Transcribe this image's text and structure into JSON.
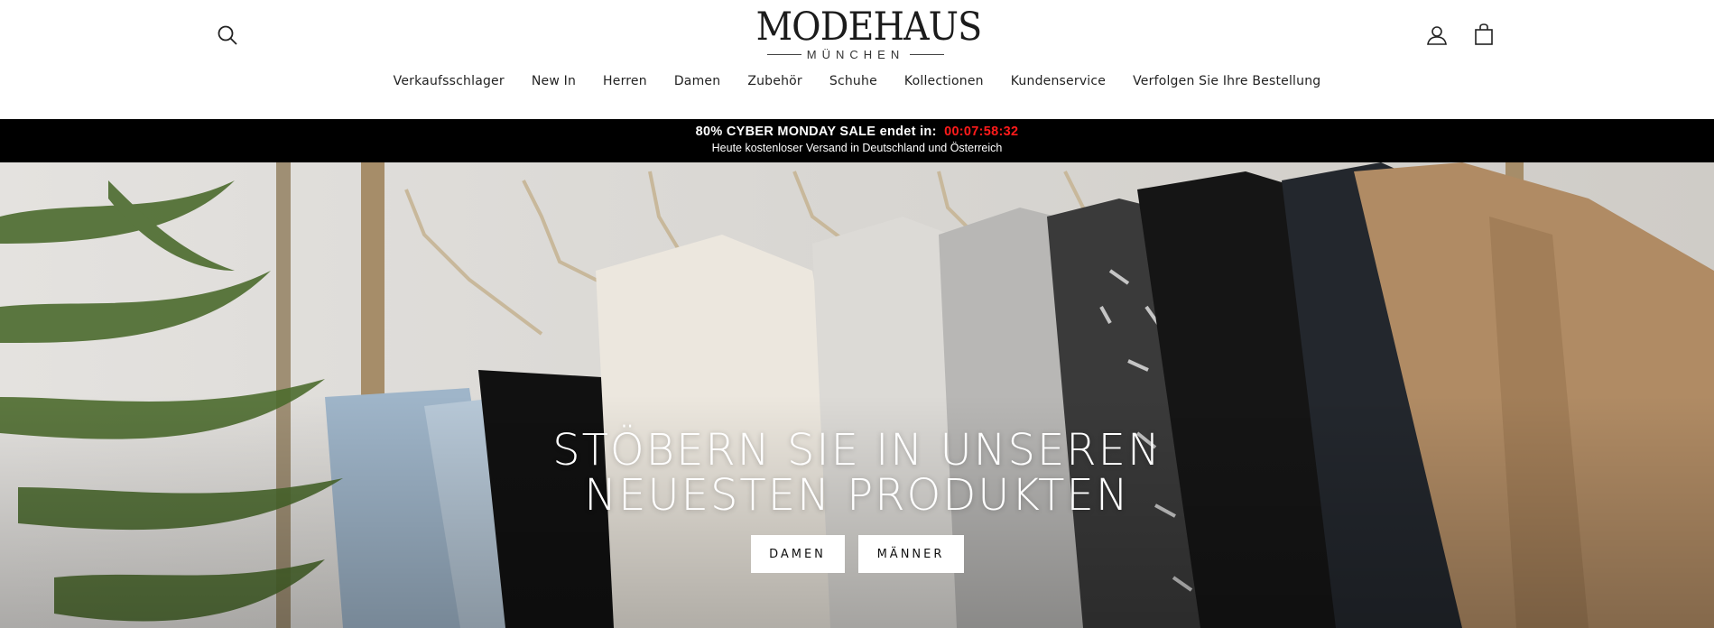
{
  "header": {
    "logo": {
      "main": "MODEHAUS",
      "sub": "MÜNCHEN"
    },
    "icons": {
      "search": "search-icon",
      "account": "user-icon",
      "cart": "shopping-bag-icon"
    }
  },
  "nav": {
    "items": [
      {
        "label": "Verkaufsschlager"
      },
      {
        "label": "New In"
      },
      {
        "label": "Herren"
      },
      {
        "label": "Damen"
      },
      {
        "label": "Zubehör"
      },
      {
        "label": "Schuhe"
      },
      {
        "label": "Kollectionen"
      },
      {
        "label": "Kundenservice"
      },
      {
        "label": "Verfolgen Sie Ihre Bestellung"
      }
    ]
  },
  "announcement": {
    "sale_text": "80% CYBER MONDAY SALE endet in:",
    "timer": "00:07:58:32",
    "shipping_text": "Heute kostenloser Versand in Deutschland und Österreich",
    "colors": {
      "background": "#000000",
      "text": "#ffffff",
      "timer": "#ff1b1b"
    }
  },
  "hero": {
    "title_line1": "STÖBERN SIE IN UNSEREN",
    "title_line2": "NEUESTEN PRODUKTEN",
    "buttons": {
      "damen": "DAMEN",
      "maenner": "MÄNNER"
    }
  }
}
